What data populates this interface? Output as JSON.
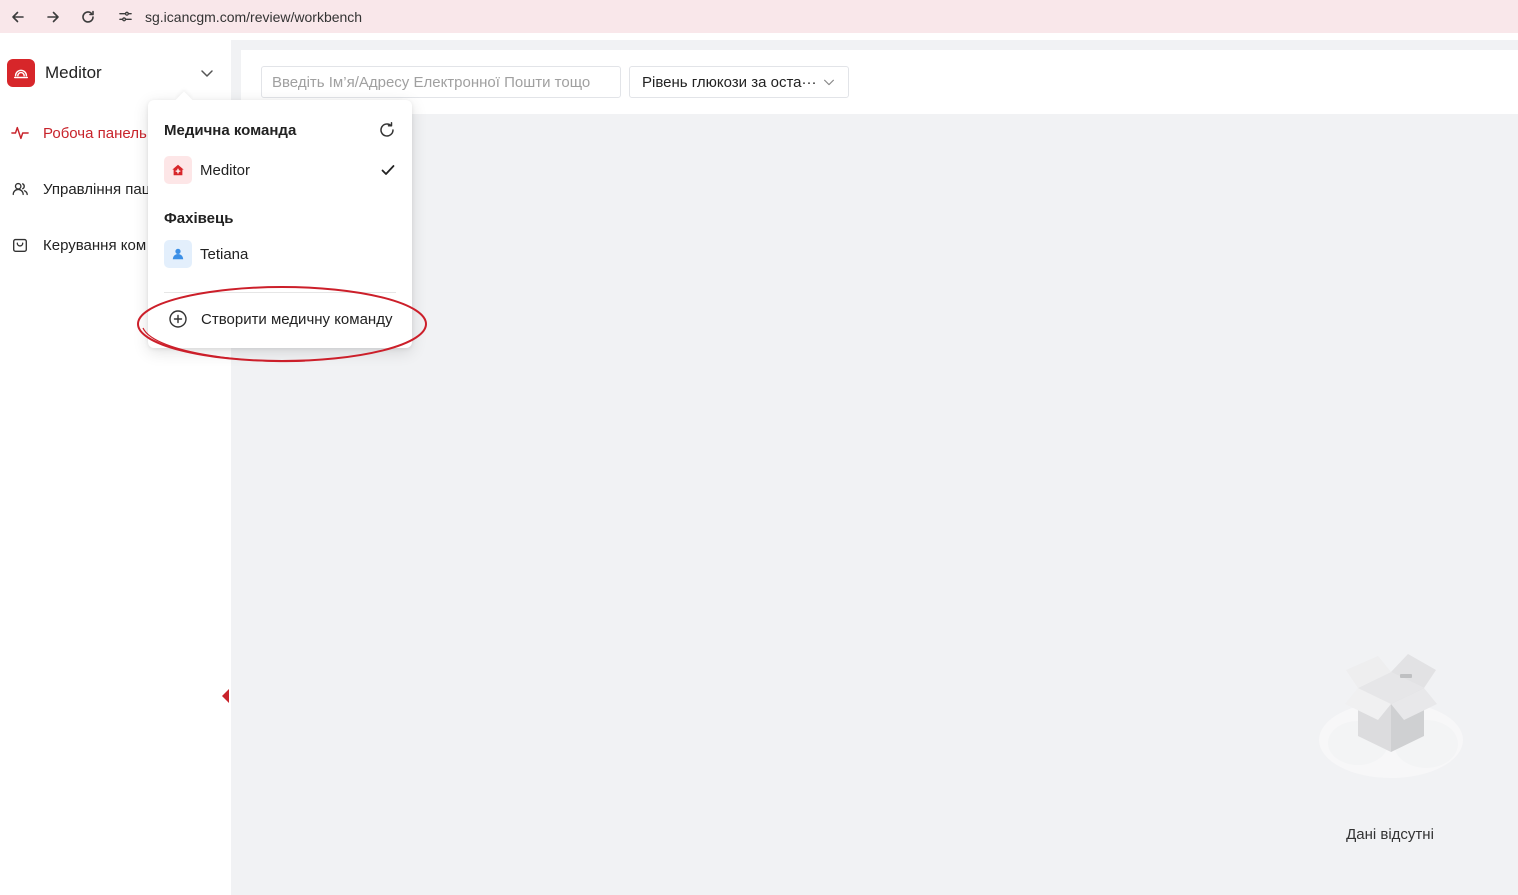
{
  "browser": {
    "url": "sg.icancgm.com/review/workbench",
    "back_icon": "arrow-left-icon",
    "forward_icon": "arrow-right-icon",
    "reload_icon": "reload-icon",
    "site_info_icon": "tune-icon"
  },
  "sidebar": {
    "brand_name": "Meditor",
    "items": [
      {
        "label": "Робоча панель",
        "icon": "pulse-icon",
        "active": true
      },
      {
        "label": "Управління пац",
        "icon": "users-icon",
        "active": false
      },
      {
        "label": "Керування ком",
        "icon": "bag-icon",
        "active": false
      }
    ]
  },
  "toolbar": {
    "search_placeholder": "Введіть Ім’я/Адресу Електронної Пошти тощо",
    "glucose_select": "Рівень глюкози за оста···"
  },
  "dropdown": {
    "team_heading": "Медична команда",
    "team_items": [
      {
        "label": "Meditor",
        "selected": true
      }
    ],
    "specialist_heading": "Фахівець",
    "specialist_items": [
      {
        "label": "Tetiana"
      }
    ],
    "create_label": "Створити медичну команду"
  },
  "empty_state": {
    "label": "Дані відсутні"
  },
  "colors": {
    "accent": "#c8232b",
    "browser_bar": "#f9e7ea",
    "main_bg": "#f1f2f4",
    "annotation": "#cc1f2a"
  }
}
